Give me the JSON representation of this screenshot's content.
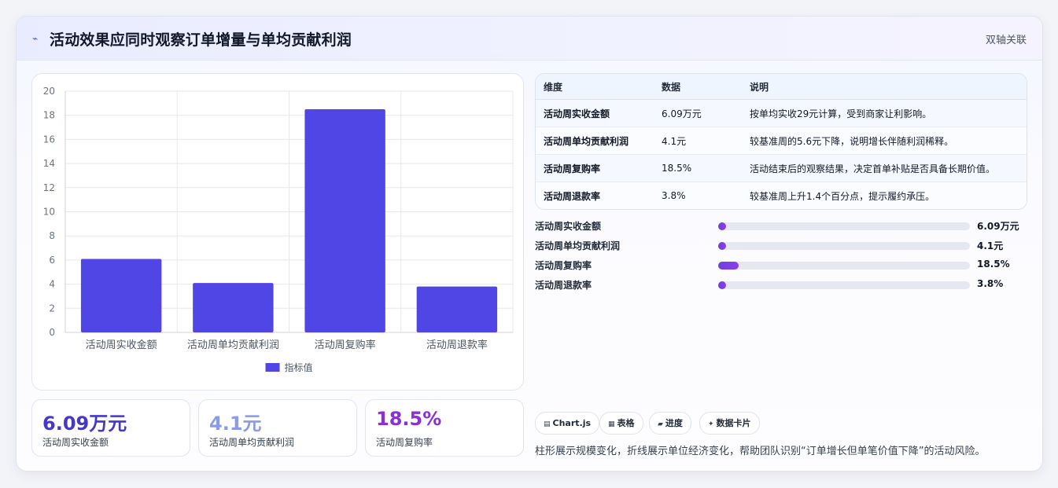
{
  "header": {
    "icon": "pulse-icon",
    "title": "活动效果应同时观察订单增量与单均贡献利润",
    "tag": "双轴关联"
  },
  "chart_data": {
    "type": "bar",
    "categories": [
      "活动周实收金额",
      "活动周单均贡献利润",
      "活动周复购率",
      "活动周退款率"
    ],
    "series": [
      {
        "name": "指标值",
        "values": [
          6.09,
          4.1,
          18.5,
          3.8
        ],
        "color": "#4f46e5"
      }
    ],
    "ylim": [
      0,
      20
    ],
    "yticks": [
      "0",
      "2",
      "4",
      "6",
      "8",
      "10",
      "12",
      "14",
      "16",
      "18",
      "20"
    ],
    "grid": true,
    "legend": "bottom"
  },
  "kpis": [
    {
      "value": "6.09万元",
      "label": "活动周实收金额",
      "color": "#4338ca"
    },
    {
      "value": "4.1元",
      "label": "活动周单均贡献利润",
      "color": "#8a9bea"
    },
    {
      "value": "18.5%",
      "label": "活动周复购率",
      "color": "#8b2fd6"
    }
  ],
  "table": {
    "headers": [
      "维度",
      "数据",
      "说明"
    ],
    "rows": [
      {
        "name": "活动周实收金额",
        "value": "6.09万元",
        "note": "按单均实收29元计算，受到商家让利影响。"
      },
      {
        "name": "活动周单均贡献利润",
        "value": "4.1元",
        "note": "较基准周的5.6元下降，说明增长伴随利润稀释。"
      },
      {
        "name": "活动周复购率",
        "value": "18.5%",
        "note": "活动结束后的观察结果，决定首单补贴是否具备长期价值。"
      },
      {
        "name": "活动周退款率",
        "value": "3.8%",
        "note": "较基准周上升1.4个百分点，提示履约承压。"
      }
    ]
  },
  "progress": [
    {
      "label": "活动周实收金额",
      "value": "6.09万元",
      "pct": 0.0
    },
    {
      "label": "活动周单均贡献利润",
      "value": "4.1元",
      "pct": 0.0
    },
    {
      "label": "活动周复购率",
      "value": "18.5%",
      "pct": 0.08
    },
    {
      "label": "活动周退款率",
      "value": "3.8%",
      "pct": 0.0
    }
  ],
  "chips": [
    {
      "icon": "chart-icon",
      "glyph": "▤",
      "label": "Chart.js"
    },
    {
      "icon": "table-icon",
      "glyph": "▦",
      "label": "表格"
    },
    {
      "icon": "progress-icon",
      "glyph": "▰",
      "label": "进度"
    },
    {
      "icon": "card-icon",
      "glyph": "✦",
      "label": "数据卡片"
    }
  ],
  "footnote": "柱形展示规模变化，折线展示单位经济变化，帮助团队识别“订单增长但单笔价值下降”的活动风险。"
}
